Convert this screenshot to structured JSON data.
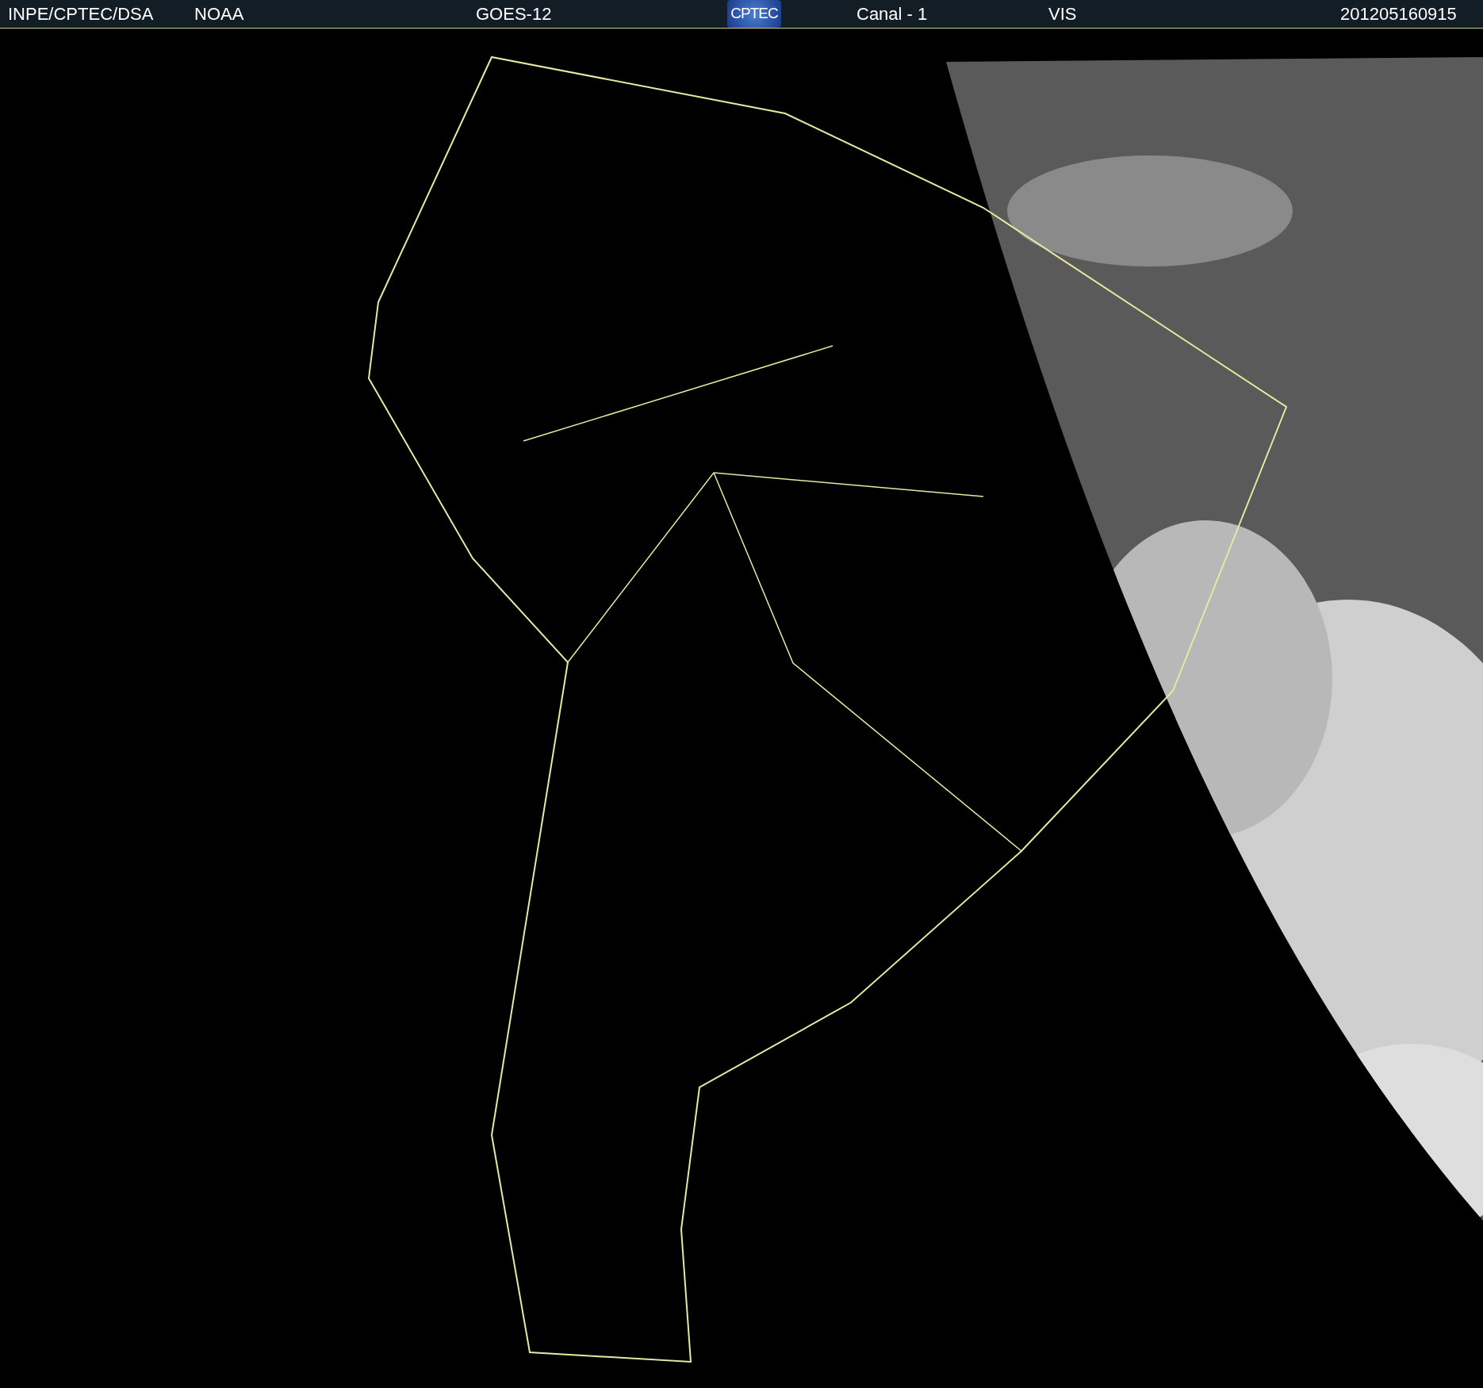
{
  "header": {
    "texts": [
      {
        "kind": "credit",
        "text": "INPE/CPTEC/DSA"
      },
      {
        "kind": "source",
        "text": "NOAA"
      },
      {
        "kind": "satellite",
        "text": "GOES-12"
      },
      {
        "kind": "logo",
        "text": "CPTEC"
      },
      {
        "kind": "channel",
        "text": "Canal - 1"
      },
      {
        "kind": "band",
        "text": "VIS"
      },
      {
        "kind": "timestamp",
        "text": "201205160915"
      }
    ]
  }
}
